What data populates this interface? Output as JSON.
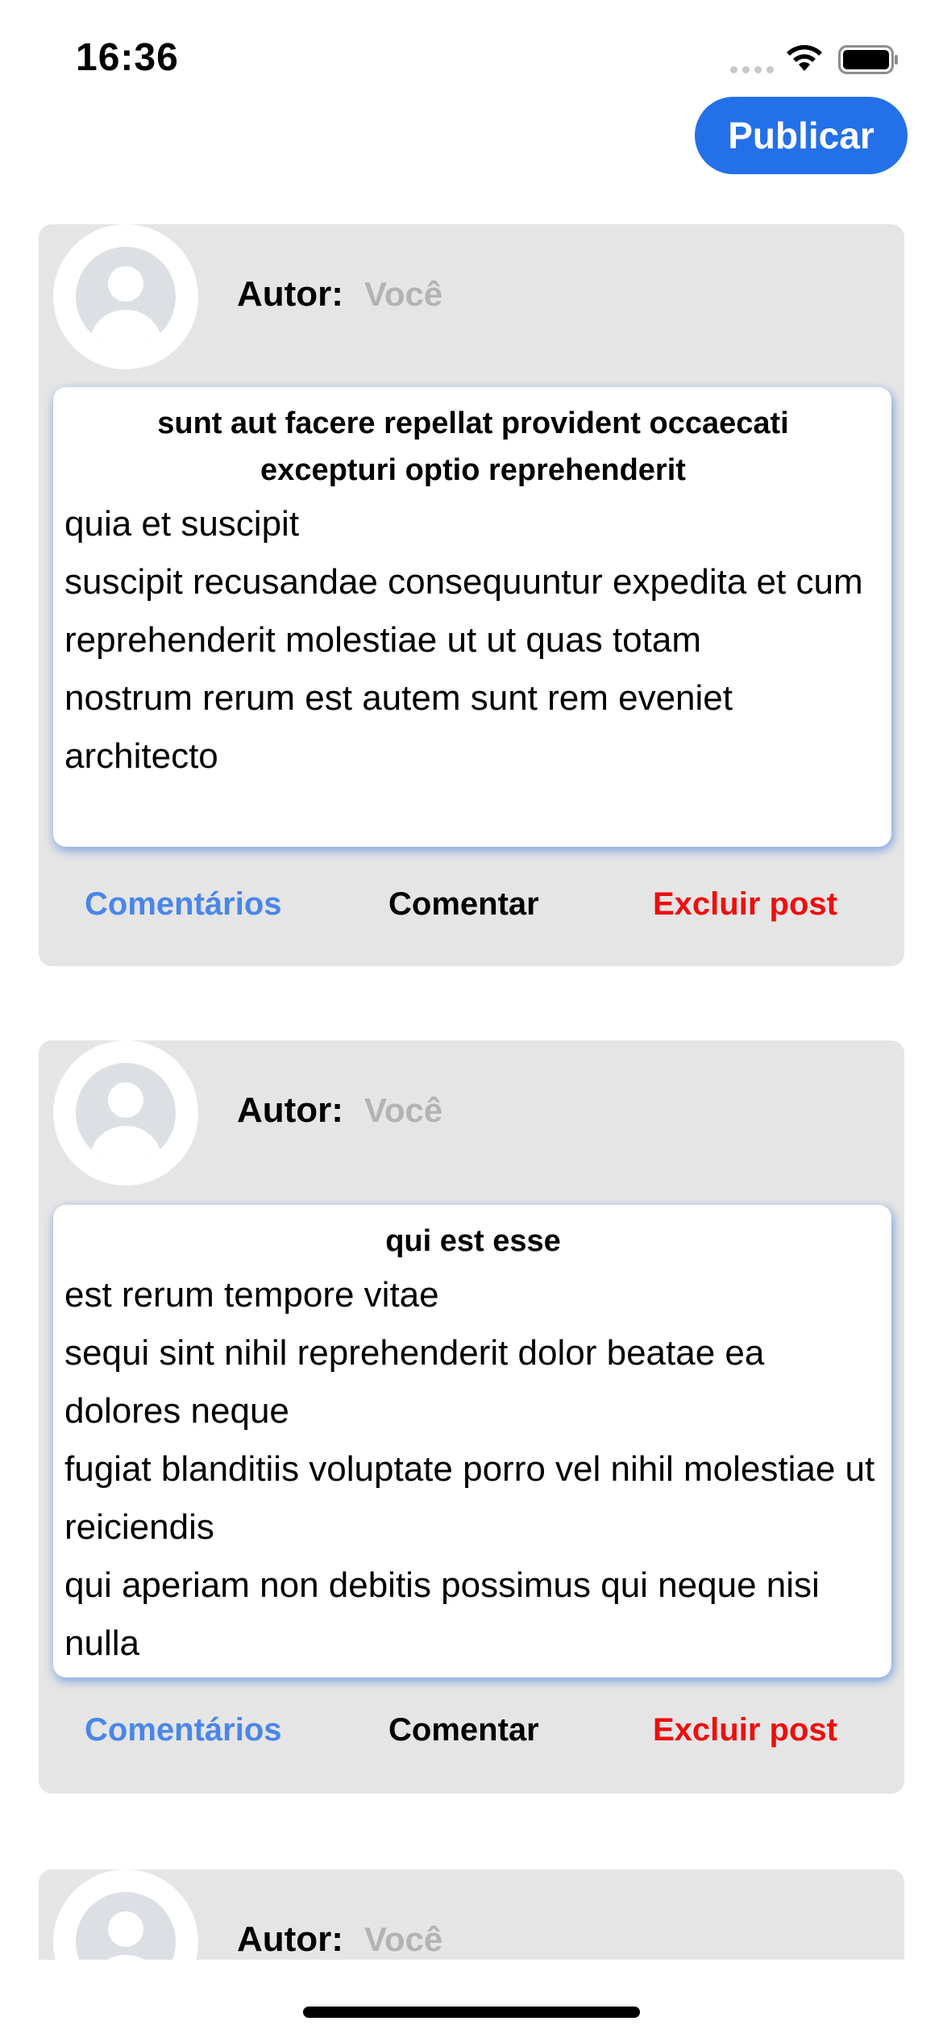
{
  "status_bar": {
    "time": "16:36",
    "signal_icon": "signal-dots-icon",
    "wifi_icon": "wifi-icon",
    "battery_icon": "battery-icon"
  },
  "header": {
    "publish_label": "Publicar",
    "accent_color": "#2470e8"
  },
  "posts": [
    {
      "author_label": "Autor:",
      "author_name": "Você",
      "title": "sunt aut facere repellat provident occaecati excepturi optio reprehenderit",
      "body": "quia et suscipit\nsuscipit recusandae consequuntur expedita et cum\nreprehenderit molestiae ut ut quas totam\nnostrum rerum est autem sunt rem eveniet architecto",
      "actions": {
        "comments": "Comentários",
        "comment": "Comentar",
        "delete": "Excluir post"
      }
    },
    {
      "author_label": "Autor:",
      "author_name": "Você",
      "title": "qui est esse",
      "body": "est rerum tempore vitae\nsequi sint nihil reprehenderit dolor beatae ea dolores neque\nfugiat blanditiis voluptate porro vel nihil molestiae ut reiciendis\nqui aperiam non debitis possimus qui neque nisi nulla",
      "actions": {
        "comments": "Comentários",
        "comment": "Comentar",
        "delete": "Excluir post"
      }
    },
    {
      "author_label": "Autor:",
      "author_name": "Você"
    }
  ],
  "colors": {
    "comments_link": "#4a86e8",
    "delete_link": "#f00d0d",
    "card_background": "#e5e5e5",
    "author_name": "#b3b3b3"
  }
}
